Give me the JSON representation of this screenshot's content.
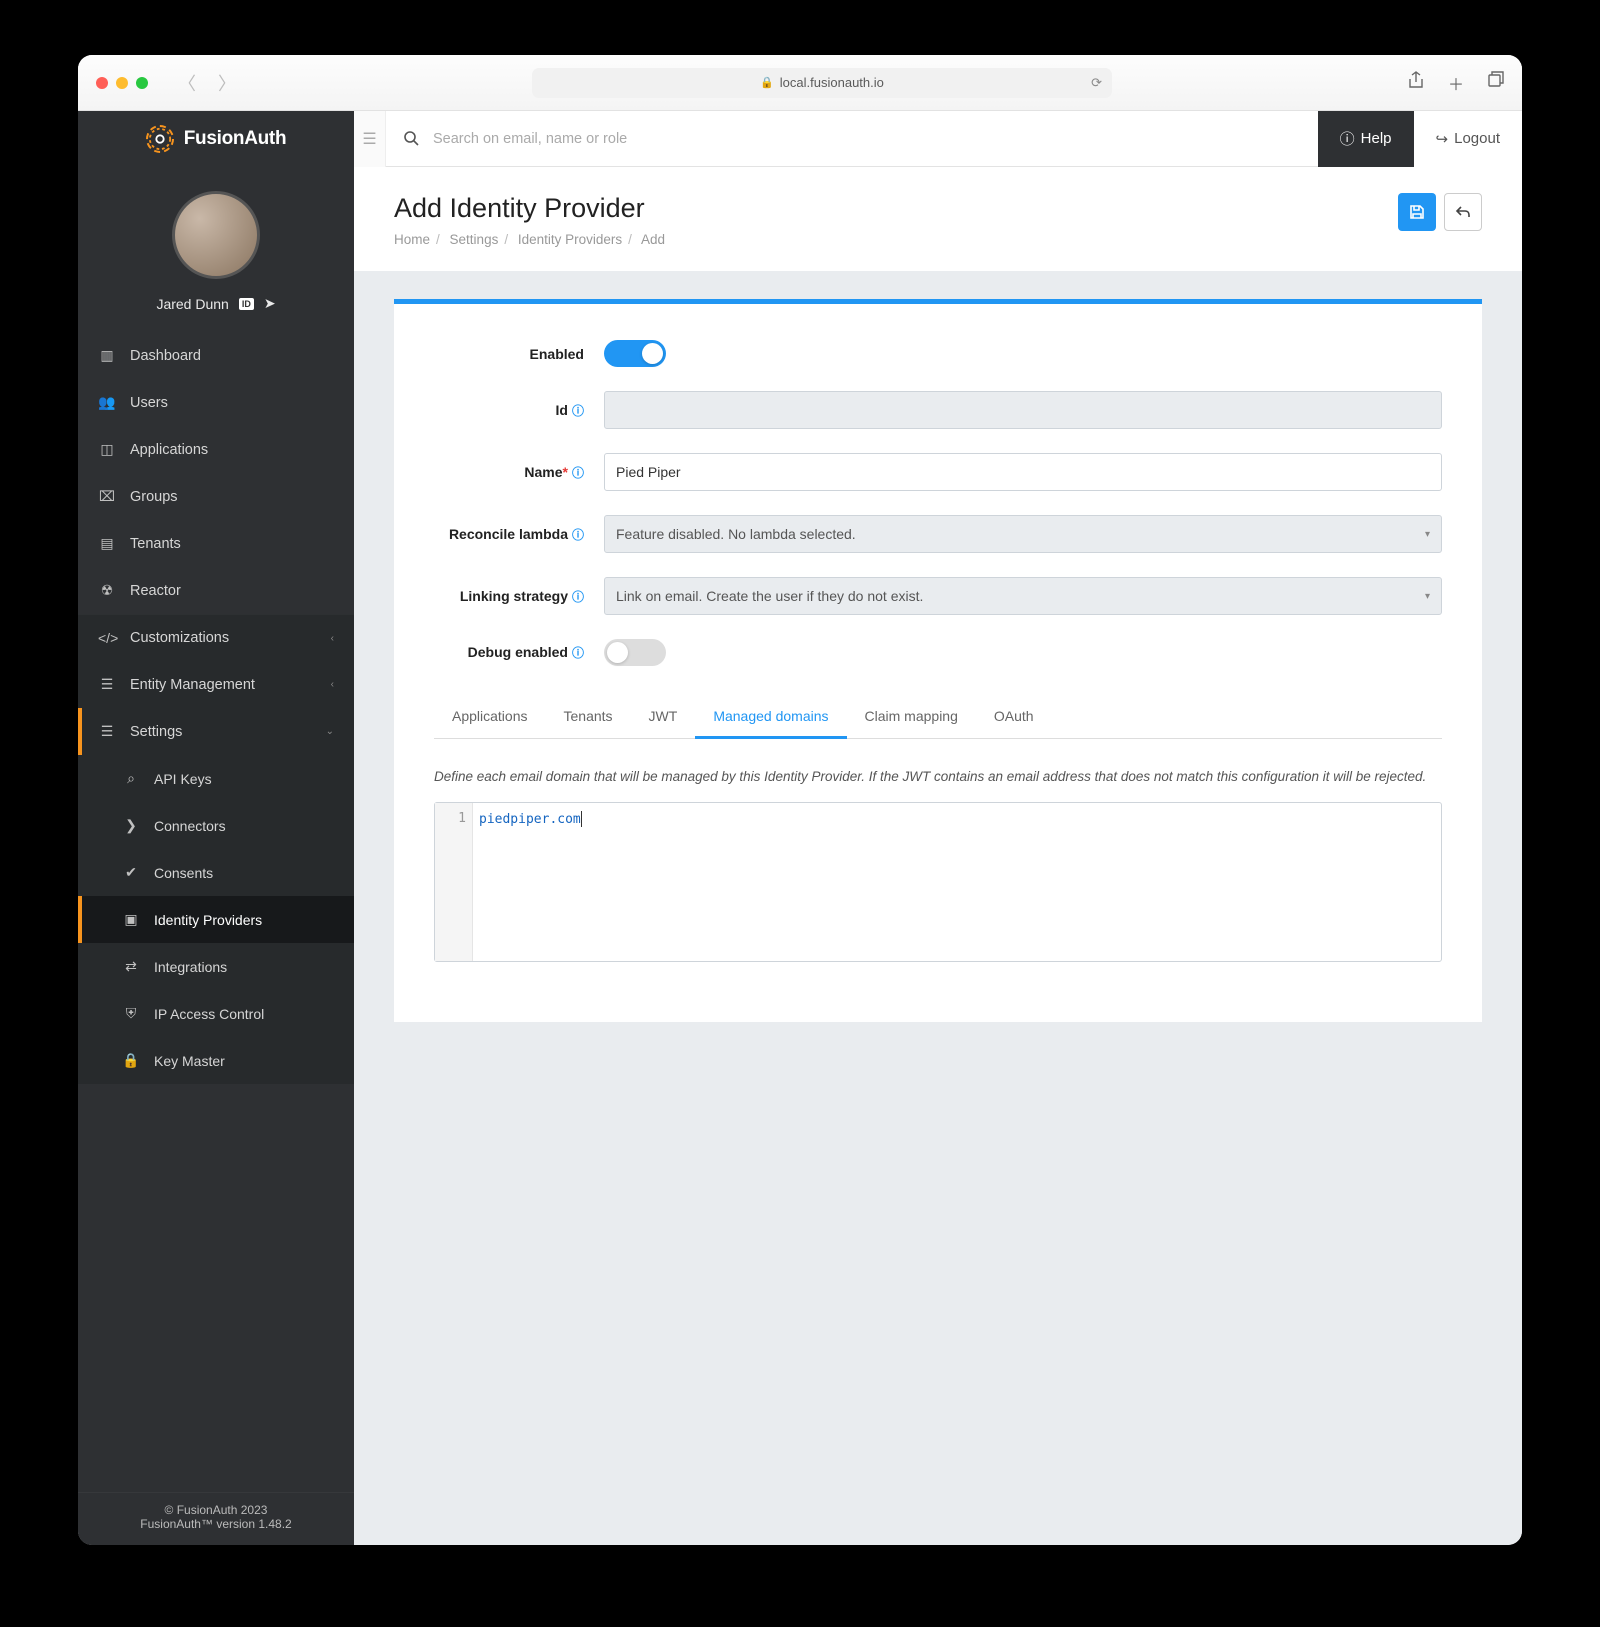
{
  "safari": {
    "url": "local.fusionauth.io"
  },
  "brand": "FusionAuth",
  "user": {
    "name": "Jared Dunn"
  },
  "nav": {
    "dashboard": "Dashboard",
    "users": "Users",
    "applications": "Applications",
    "groups": "Groups",
    "tenants": "Tenants",
    "reactor": "Reactor",
    "customizations": "Customizations",
    "entity": "Entity Management",
    "settings": "Settings",
    "sub": {
      "api_keys": "API Keys",
      "connectors": "Connectors",
      "consents": "Consents",
      "identity_providers": "Identity Providers",
      "integrations": "Integrations",
      "ip_access": "IP Access Control",
      "key_master": "Key Master"
    }
  },
  "footer": {
    "copyright": "© FusionAuth 2023",
    "version": "FusionAuth™ version 1.48.2"
  },
  "topbar": {
    "search_placeholder": "Search on email, name or role",
    "help": "Help",
    "logout": "Logout"
  },
  "page": {
    "title": "Add Identity Provider",
    "crumb_home": "Home",
    "crumb_settings": "Settings",
    "crumb_idp": "Identity Providers",
    "crumb_add": "Add"
  },
  "form": {
    "enabled_label": "Enabled",
    "enabled": true,
    "id_label": "Id",
    "id_value": "",
    "name_label": "Name",
    "name_value": "Pied Piper",
    "reconcile_label": "Reconcile lambda",
    "reconcile_value": "Feature disabled. No lambda selected.",
    "linking_label": "Linking strategy",
    "linking_value": "Link on email. Create the user if they do not exist.",
    "debug_label": "Debug enabled",
    "debug_enabled": false
  },
  "tabs": {
    "applications": "Applications",
    "tenants": "Tenants",
    "jwt": "JWT",
    "managed_domains": "Managed domains",
    "claim_mapping": "Claim mapping",
    "oauth": "OAuth"
  },
  "managed_domains": {
    "help": "Define each email domain that will be managed by this Identity Provider. If the JWT contains an email address that does not match this configuration it will be rejected.",
    "line_no": "1",
    "value": "piedpiper.com"
  }
}
